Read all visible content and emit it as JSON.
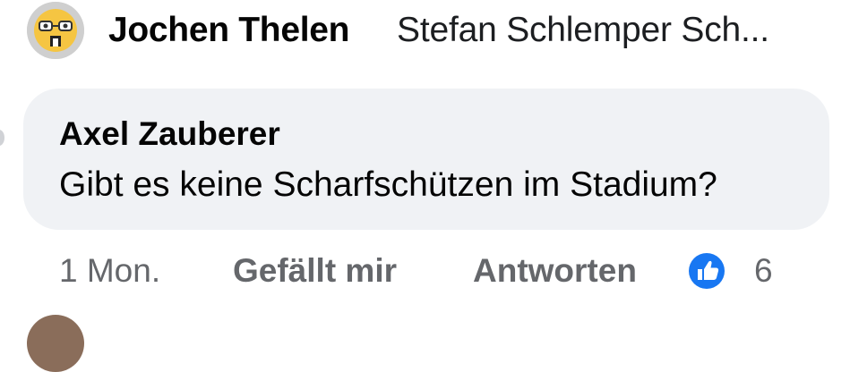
{
  "post": {
    "author_name": "Jochen Thelen",
    "reply_preview": "Stefan Schlemper Sch..."
  },
  "comment": {
    "author": "Axel Zauberer",
    "text": "Gibt es keine Scharfschützen im Stadium?",
    "time": "1 Mon.",
    "like_label": "Gefällt mir",
    "reply_label": "Antworten",
    "reaction_count": "6"
  },
  "colors": {
    "bubble_bg": "#f0f2f5",
    "meta_text": "#65676b",
    "like_blue": "#1877f2"
  }
}
